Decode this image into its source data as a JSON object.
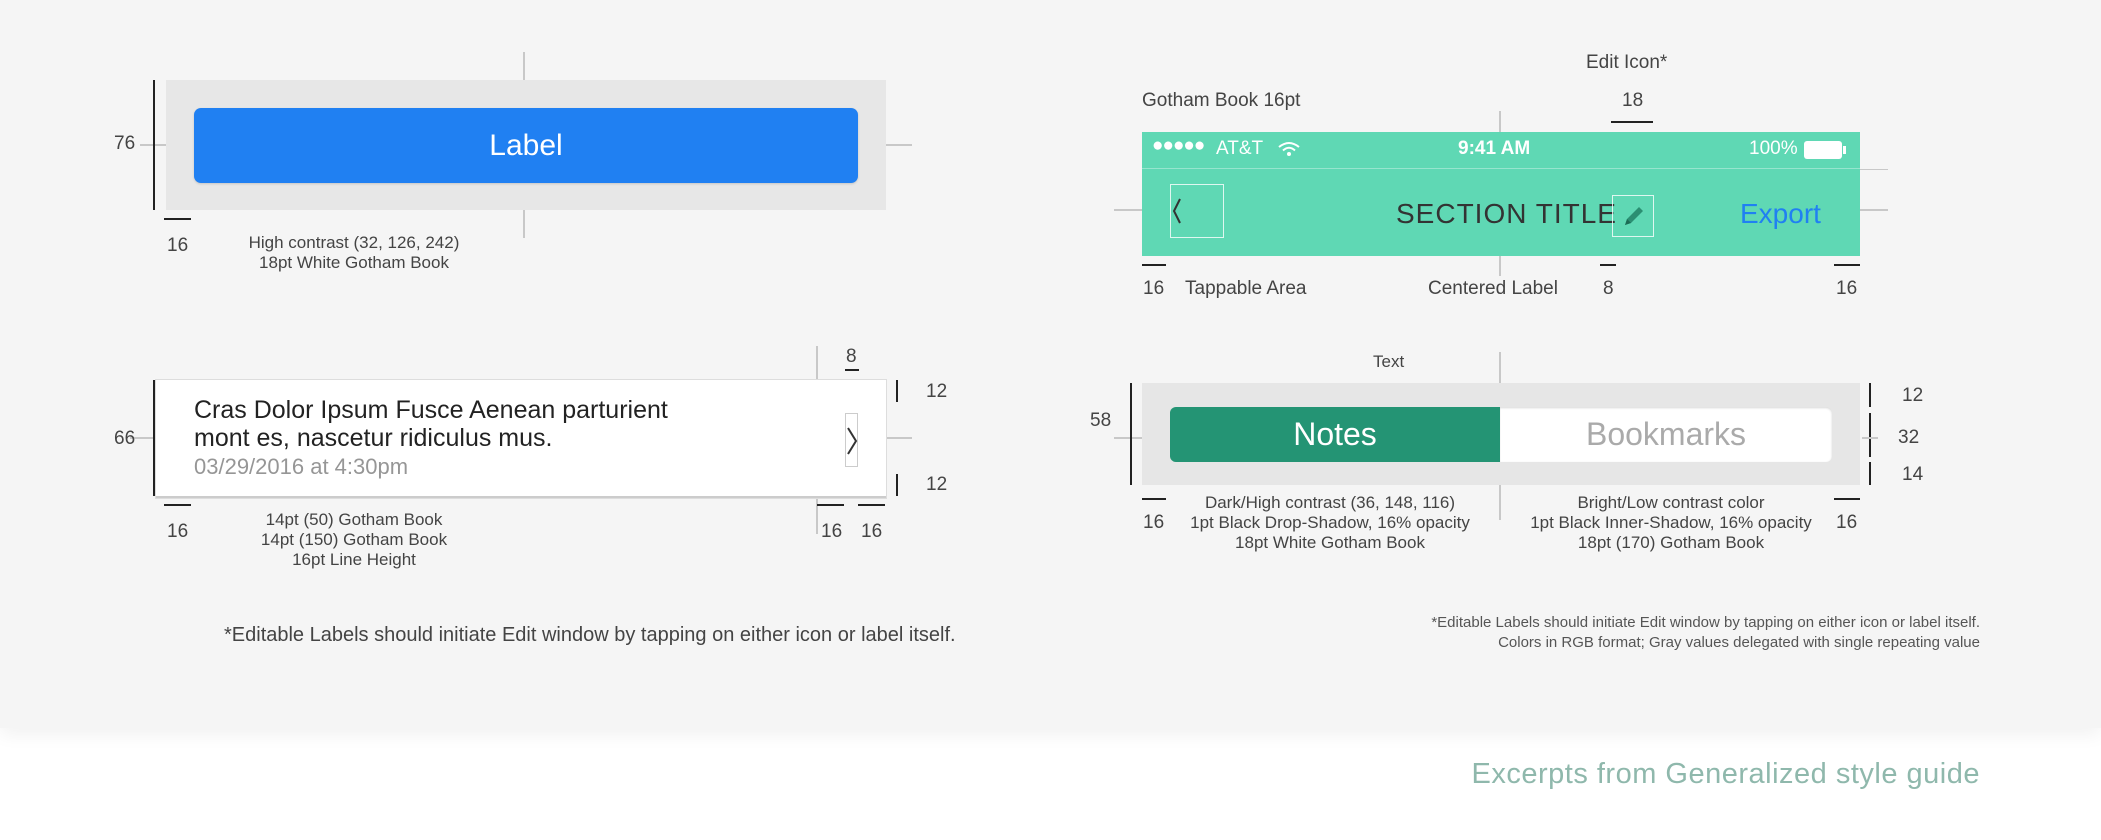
{
  "section_button": {
    "height_dim": "76",
    "margin_dim": "16",
    "button_label": "Label",
    "caption_line1": "High contrast (32, 126, 242)",
    "caption_line2": "18pt White Gotham Book",
    "button_color": "#2080f2"
  },
  "section_navbar": {
    "font_note": "Gotham Book 16pt",
    "edit_icon_note": "Edit Icon*",
    "edit_icon_dim": "18",
    "status": {
      "carrier": "AT&T",
      "time": "9:41 AM",
      "battery": "100%"
    },
    "title": "SECTION TITLE",
    "export_label": "Export",
    "left_dim": "16",
    "tappable_label": "Tappable Area",
    "centered_label": "Centered Label",
    "gap_dim": "8",
    "right_dim": "16",
    "bar_color": "#5fd8b4"
  },
  "section_list": {
    "height_dim": "66",
    "top_dim": "8",
    "pad_top_dim": "12",
    "pad_bottom_dim": "12",
    "title_line1": "Cras Dolor Ipsum Fusce Aenean parturient",
    "title_line2": "mont es, nascetur ridiculus mus.",
    "subtitle": "03/29/2016 at 4:30pm",
    "left_dim": "16",
    "right_dim_a": "16",
    "right_dim_b": "16",
    "caption_line1": "14pt (50) Gotham Book",
    "caption_line2": "14pt (150) Gotham Book",
    "caption_line3": "16pt Line Height"
  },
  "section_segmented": {
    "text_note": "Text",
    "height_dim": "58",
    "top_dim": "12",
    "mid_dim": "32",
    "bottom_dim": "14",
    "left_label": "Notes",
    "right_label": "Bookmarks",
    "left_dim": "16",
    "right_dim": "16",
    "left_caption1": "Dark/High contrast (36, 148, 116)",
    "left_caption2": "1pt Black Drop-Shadow, 16% opacity",
    "left_caption3": "18pt White Gotham Book",
    "right_caption1": "Bright/Low contrast color",
    "right_caption2": "1pt Black Inner-Shadow, 16% opacity",
    "right_caption3": "18pt (170) Gotham Book",
    "dark_color": "#249474"
  },
  "footnotes": {
    "left": "*Editable Labels should initiate Edit window by tapping on either icon or label itself.",
    "right_line1": "*Editable Labels should initiate Edit window by tapping on either icon or label itself.",
    "right_line2": "Colors in RGB format; Gray values delegated with single repeating value"
  },
  "footer": {
    "title": "Excerpts from Generalized style guide"
  }
}
